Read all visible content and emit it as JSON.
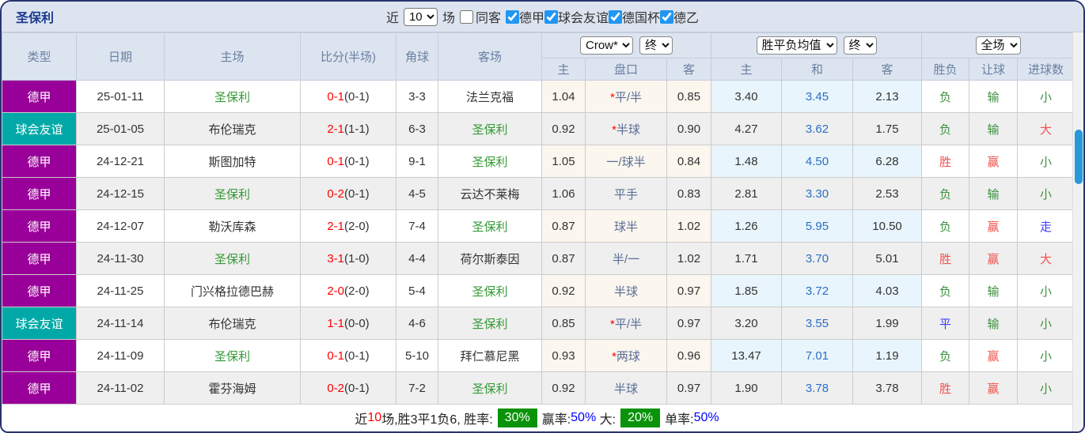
{
  "colors": {
    "border-navy": "#28346e",
    "purple": "#990099",
    "teal": "#00a9a7",
    "self-green": "#339933",
    "score-red": "#ff0000",
    "res-red": "#ef5350",
    "res-green": "#3d9140",
    "res-blue": "#3b3bff",
    "badge-green": "#0a930a",
    "thumb-blue": "#2799d9"
  },
  "header": {
    "title": "圣保利",
    "recent_label": "近",
    "recent_value": "10",
    "matches_label": "场",
    "same_opponent_label": "同客",
    "same_opponent_checked": false,
    "leagues": [
      {
        "label": "德甲",
        "checked": true
      },
      {
        "label": "球会友谊",
        "checked": true
      },
      {
        "label": "德国杯",
        "checked": true
      },
      {
        "label": "德乙",
        "checked": true
      }
    ]
  },
  "table": {
    "columns": [
      "类型",
      "日期",
      "主场",
      "比分(半场)",
      "角球",
      "客场"
    ],
    "odds_group": {
      "company": "Crow*",
      "period": "终",
      "sub": [
        "主",
        "盘口",
        "客"
      ]
    },
    "avg_group": {
      "name": "胜平负均值",
      "period": "终",
      "sub": [
        "主",
        "和",
        "客"
      ]
    },
    "result_group": {
      "scope": "全场",
      "sub": [
        "胜负",
        "让球",
        "进球数"
      ]
    },
    "rows": [
      {
        "type": "德甲",
        "type_color": "purple",
        "date": "25-01-11",
        "home": "圣保利",
        "home_self": true,
        "score": "0-1",
        "half": "(0-1)",
        "corner": "3-3",
        "away": "法兰克福",
        "away_self": false,
        "odds": [
          "1.04",
          "*平/半",
          "0.85"
        ],
        "avg": [
          "3.40",
          "3.45",
          "2.13"
        ],
        "results": [
          {
            "t": "负",
            "c": "green"
          },
          {
            "t": "输",
            "c": "green"
          },
          {
            "t": "小",
            "c": "green"
          }
        ]
      },
      {
        "type": "球会友谊",
        "type_color": "teal",
        "date": "25-01-05",
        "home": "布伦瑞克",
        "home_self": false,
        "score": "2-1",
        "half": "(1-1)",
        "corner": "6-3",
        "away": "圣保利",
        "away_self": true,
        "odds": [
          "0.92",
          "*半球",
          "0.90"
        ],
        "avg": [
          "4.27",
          "3.62",
          "1.75"
        ],
        "results": [
          {
            "t": "负",
            "c": "green"
          },
          {
            "t": "输",
            "c": "green"
          },
          {
            "t": "大",
            "c": "red"
          }
        ]
      },
      {
        "type": "德甲",
        "type_color": "purple",
        "date": "24-12-21",
        "home": "斯图加特",
        "home_self": false,
        "score": "0-1",
        "half": "(0-1)",
        "corner": "9-1",
        "away": "圣保利",
        "away_self": true,
        "odds": [
          "1.05",
          "一/球半",
          "0.84"
        ],
        "avg": [
          "1.48",
          "4.50",
          "6.28"
        ],
        "results": [
          {
            "t": "胜",
            "c": "red"
          },
          {
            "t": "赢",
            "c": "red"
          },
          {
            "t": "小",
            "c": "green"
          }
        ]
      },
      {
        "type": "德甲",
        "type_color": "purple",
        "date": "24-12-15",
        "home": "圣保利",
        "home_self": true,
        "score": "0-2",
        "half": "(0-1)",
        "corner": "4-5",
        "away": "云达不莱梅",
        "away_self": false,
        "odds": [
          "1.06",
          "平手",
          "0.83"
        ],
        "avg": [
          "2.81",
          "3.30",
          "2.53"
        ],
        "results": [
          {
            "t": "负",
            "c": "green"
          },
          {
            "t": "输",
            "c": "green"
          },
          {
            "t": "小",
            "c": "green"
          }
        ]
      },
      {
        "type": "德甲",
        "type_color": "purple",
        "date": "24-12-07",
        "home": "勒沃库森",
        "home_self": false,
        "score": "2-1",
        "half": "(2-0)",
        "corner": "7-4",
        "away": "圣保利",
        "away_self": true,
        "odds": [
          "0.87",
          "球半",
          "1.02"
        ],
        "avg": [
          "1.26",
          "5.95",
          "10.50"
        ],
        "results": [
          {
            "t": "负",
            "c": "green"
          },
          {
            "t": "赢",
            "c": "red"
          },
          {
            "t": "走",
            "c": "blue"
          }
        ]
      },
      {
        "type": "德甲",
        "type_color": "purple",
        "date": "24-11-30",
        "home": "圣保利",
        "home_self": true,
        "score": "3-1",
        "half": "(1-0)",
        "corner": "4-4",
        "away": "荷尔斯泰因",
        "away_self": false,
        "odds": [
          "0.87",
          "半/一",
          "1.02"
        ],
        "avg": [
          "1.71",
          "3.70",
          "5.01"
        ],
        "results": [
          {
            "t": "胜",
            "c": "red"
          },
          {
            "t": "赢",
            "c": "red"
          },
          {
            "t": "大",
            "c": "red"
          }
        ]
      },
      {
        "type": "德甲",
        "type_color": "purple",
        "date": "24-11-25",
        "home": "门兴格拉德巴赫",
        "home_self": false,
        "score": "2-0",
        "half": "(2-0)",
        "corner": "5-4",
        "away": "圣保利",
        "away_self": true,
        "odds": [
          "0.92",
          "半球",
          "0.97"
        ],
        "avg": [
          "1.85",
          "3.72",
          "4.03"
        ],
        "results": [
          {
            "t": "负",
            "c": "green"
          },
          {
            "t": "输",
            "c": "green"
          },
          {
            "t": "小",
            "c": "green"
          }
        ]
      },
      {
        "type": "球会友谊",
        "type_color": "teal",
        "date": "24-11-14",
        "home": "布伦瑞克",
        "home_self": false,
        "score": "1-1",
        "half": "(0-0)",
        "corner": "4-6",
        "away": "圣保利",
        "away_self": true,
        "odds": [
          "0.85",
          "*平/半",
          "0.97"
        ],
        "avg": [
          "3.20",
          "3.55",
          "1.99"
        ],
        "results": [
          {
            "t": "平",
            "c": "blue"
          },
          {
            "t": "输",
            "c": "green"
          },
          {
            "t": "小",
            "c": "green"
          }
        ]
      },
      {
        "type": "德甲",
        "type_color": "purple",
        "date": "24-11-09",
        "home": "圣保利",
        "home_self": true,
        "score": "0-1",
        "half": "(0-1)",
        "corner": "5-10",
        "away": "拜仁慕尼黑",
        "away_self": false,
        "odds": [
          "0.93",
          "*两球",
          "0.96"
        ],
        "avg": [
          "13.47",
          "7.01",
          "1.19"
        ],
        "results": [
          {
            "t": "负",
            "c": "green"
          },
          {
            "t": "赢",
            "c": "red"
          },
          {
            "t": "小",
            "c": "green"
          }
        ]
      },
      {
        "type": "德甲",
        "type_color": "purple",
        "date": "24-11-02",
        "home": "霍芬海姆",
        "home_self": false,
        "score": "0-2",
        "half": "(0-1)",
        "corner": "7-2",
        "away": "圣保利",
        "away_self": true,
        "odds": [
          "0.92",
          "半球",
          "0.97"
        ],
        "avg": [
          "1.90",
          "3.78",
          "3.78"
        ],
        "results": [
          {
            "t": "胜",
            "c": "red"
          },
          {
            "t": "赢",
            "c": "red"
          },
          {
            "t": "小",
            "c": "green"
          }
        ]
      }
    ]
  },
  "summary": {
    "parts": [
      {
        "text": "近",
        "style": "plain"
      },
      {
        "text": "10",
        "style": "red"
      },
      {
        "text": "场,胜3平1负6, 胜率:",
        "style": "plain"
      },
      {
        "text": "30%",
        "style": "badge"
      },
      {
        "text": "赢率:",
        "style": "plain"
      },
      {
        "text": "50%",
        "style": "blue"
      },
      {
        "text": " 大:",
        "style": "plain"
      },
      {
        "text": "20%",
        "style": "badge"
      },
      {
        "text": "单率:",
        "style": "plain"
      },
      {
        "text": "50%",
        "style": "blue"
      }
    ]
  }
}
